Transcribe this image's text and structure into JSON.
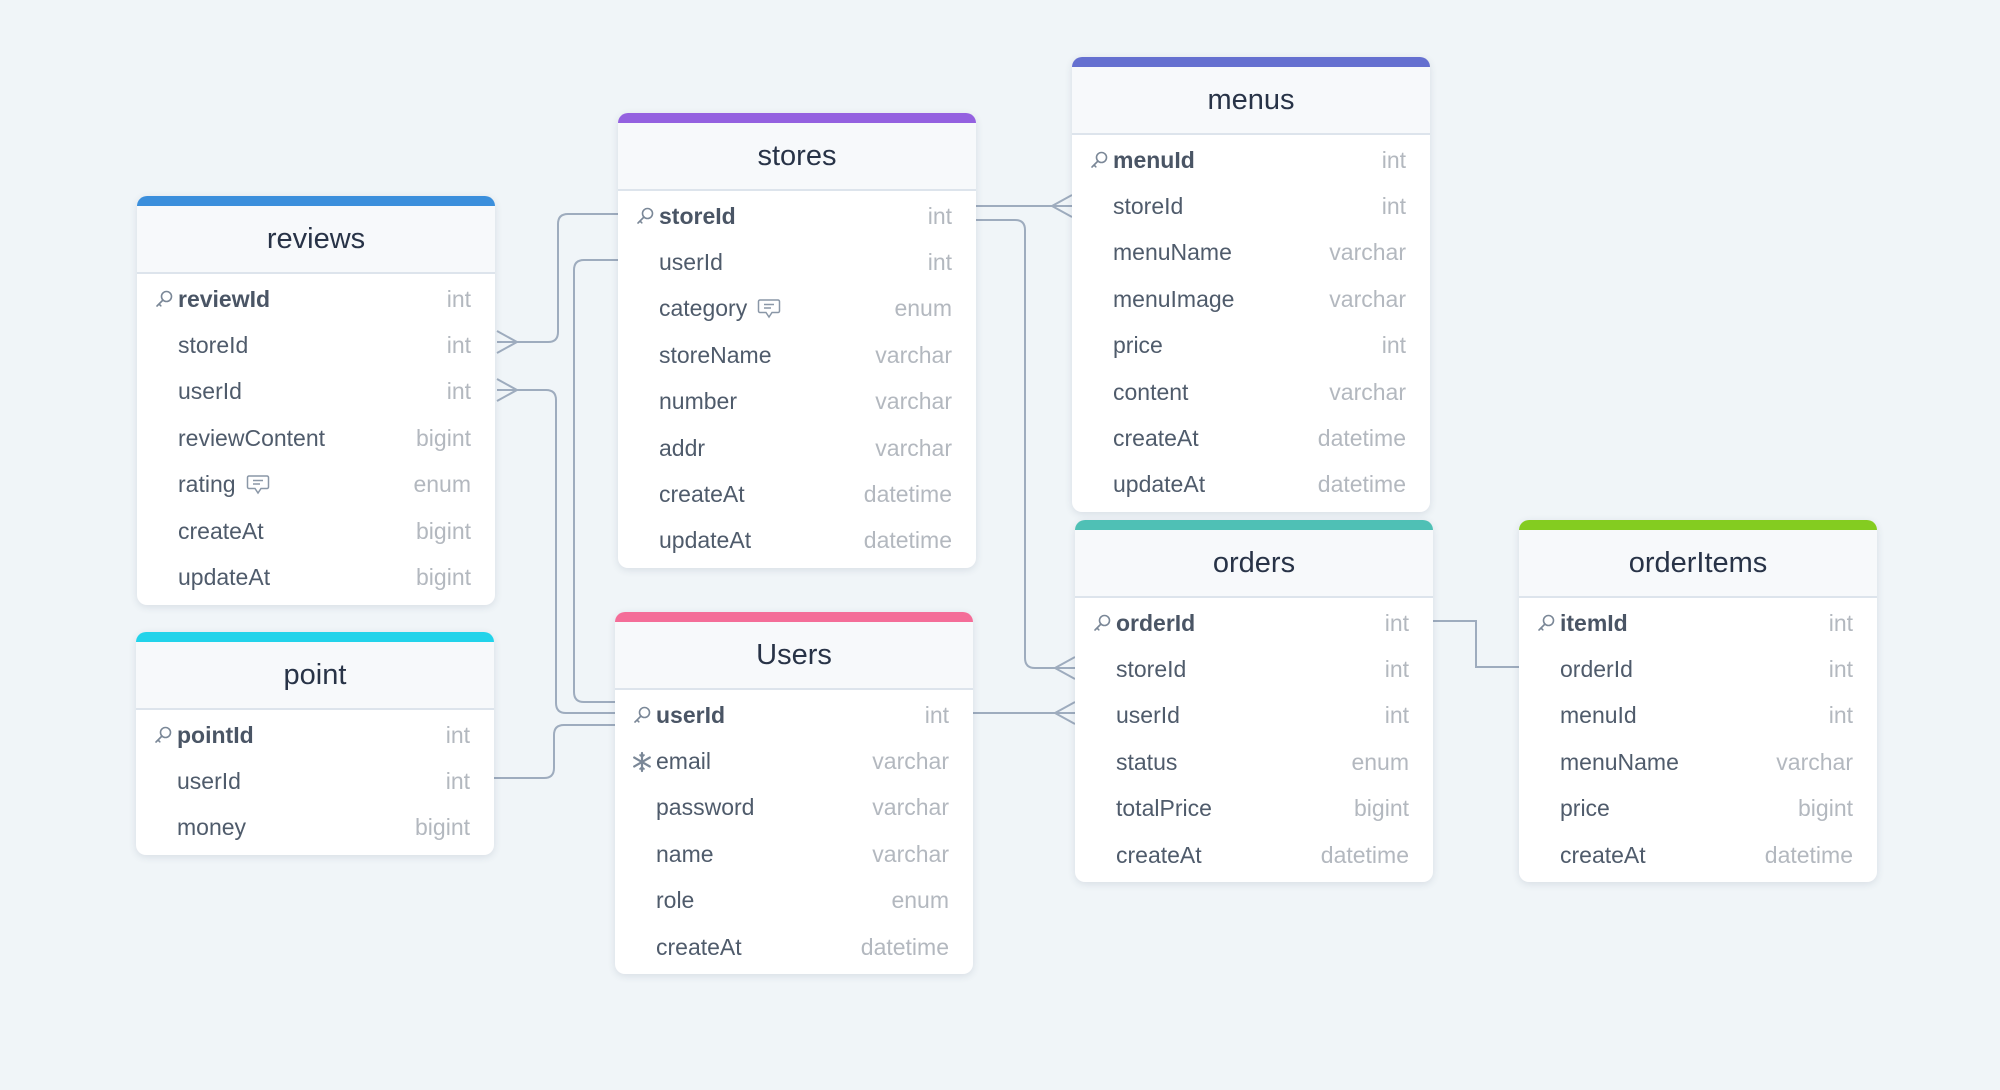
{
  "diagram": {
    "type": "entity-relationship",
    "tables": [
      {
        "id": "reviews",
        "name": "reviews",
        "color": "#3b8fdc",
        "fields": [
          {
            "name": "reviewId",
            "type": "int",
            "pk": true
          },
          {
            "name": "storeId",
            "type": "int"
          },
          {
            "name": "userId",
            "type": "int"
          },
          {
            "name": "reviewContent",
            "type": "bigint"
          },
          {
            "name": "rating",
            "type": "enum",
            "note": true
          },
          {
            "name": "createAt",
            "type": "bigint"
          },
          {
            "name": "updateAt",
            "type": "bigint"
          }
        ]
      },
      {
        "id": "point",
        "name": "point",
        "color": "#22d3ea",
        "fields": [
          {
            "name": "pointId",
            "type": "int",
            "pk": true
          },
          {
            "name": "userId",
            "type": "int"
          },
          {
            "name": "money",
            "type": "bigint"
          }
        ]
      },
      {
        "id": "stores",
        "name": "stores",
        "color": "#9461e0",
        "fields": [
          {
            "name": "storeId",
            "type": "int",
            "pk": true
          },
          {
            "name": "userId",
            "type": "int"
          },
          {
            "name": "category",
            "type": "enum",
            "note": true
          },
          {
            "name": "storeName",
            "type": "varchar"
          },
          {
            "name": "number",
            "type": "varchar"
          },
          {
            "name": "addr",
            "type": "varchar"
          },
          {
            "name": "createAt",
            "type": "datetime"
          },
          {
            "name": "updateAt",
            "type": "datetime"
          }
        ]
      },
      {
        "id": "users",
        "name": "Users",
        "color": "#f46d98",
        "fields": [
          {
            "name": "userId",
            "type": "int",
            "pk": true
          },
          {
            "name": "email",
            "type": "varchar",
            "unique": true
          },
          {
            "name": "password",
            "type": "varchar"
          },
          {
            "name": "name",
            "type": "varchar"
          },
          {
            "name": "role",
            "type": "enum"
          },
          {
            "name": "createAt",
            "type": "datetime"
          }
        ]
      },
      {
        "id": "menus",
        "name": "menus",
        "color": "#6570d0",
        "fields": [
          {
            "name": "menuId",
            "type": "int",
            "pk": true
          },
          {
            "name": "storeId",
            "type": "int"
          },
          {
            "name": "menuName",
            "type": "varchar"
          },
          {
            "name": "menuImage",
            "type": "varchar"
          },
          {
            "name": "price",
            "type": "int"
          },
          {
            "name": "content",
            "type": "varchar"
          },
          {
            "name": "createAt",
            "type": "datetime"
          },
          {
            "name": "updateAt",
            "type": "datetime"
          }
        ]
      },
      {
        "id": "orders",
        "name": "orders",
        "color": "#4fc0b5",
        "fields": [
          {
            "name": "orderId",
            "type": "int",
            "pk": true
          },
          {
            "name": "storeId",
            "type": "int"
          },
          {
            "name": "userId",
            "type": "int"
          },
          {
            "name": "status",
            "type": "enum"
          },
          {
            "name": "totalPrice",
            "type": "bigint"
          },
          {
            "name": "createAt",
            "type": "datetime"
          }
        ]
      },
      {
        "id": "orderItems",
        "name": "orderItems",
        "color": "#84cc20",
        "fields": [
          {
            "name": "itemId",
            "type": "int",
            "pk": true
          },
          {
            "name": "orderId",
            "type": "int"
          },
          {
            "name": "menuId",
            "type": "int"
          },
          {
            "name": "menuName",
            "type": "varchar"
          },
          {
            "name": "price",
            "type": "bigint"
          },
          {
            "name": "createAt",
            "type": "datetime"
          }
        ]
      }
    ],
    "relations": [
      {
        "from": "stores.storeId",
        "to": "reviews.storeId",
        "cardinality": "one-to-many"
      },
      {
        "from": "users.userId",
        "to": "reviews.userId",
        "cardinality": "one-to-many"
      },
      {
        "from": "users.userId",
        "to": "stores.userId",
        "cardinality": "one-to-one"
      },
      {
        "from": "users.userId",
        "to": "point.userId",
        "cardinality": "one-to-one"
      },
      {
        "from": "stores.storeId",
        "to": "menus.storeId",
        "cardinality": "one-to-many"
      },
      {
        "from": "stores.storeId",
        "to": "orders.storeId",
        "cardinality": "one-to-many"
      },
      {
        "from": "users.userId",
        "to": "orders.userId",
        "cardinality": "one-to-many"
      },
      {
        "from": "orders.orderId",
        "to": "orderItems.orderId",
        "cardinality": "one-to-one"
      }
    ],
    "icons": {
      "primary_key": "key-icon",
      "unique": "snowflake-icon",
      "note": "comment-icon"
    }
  }
}
